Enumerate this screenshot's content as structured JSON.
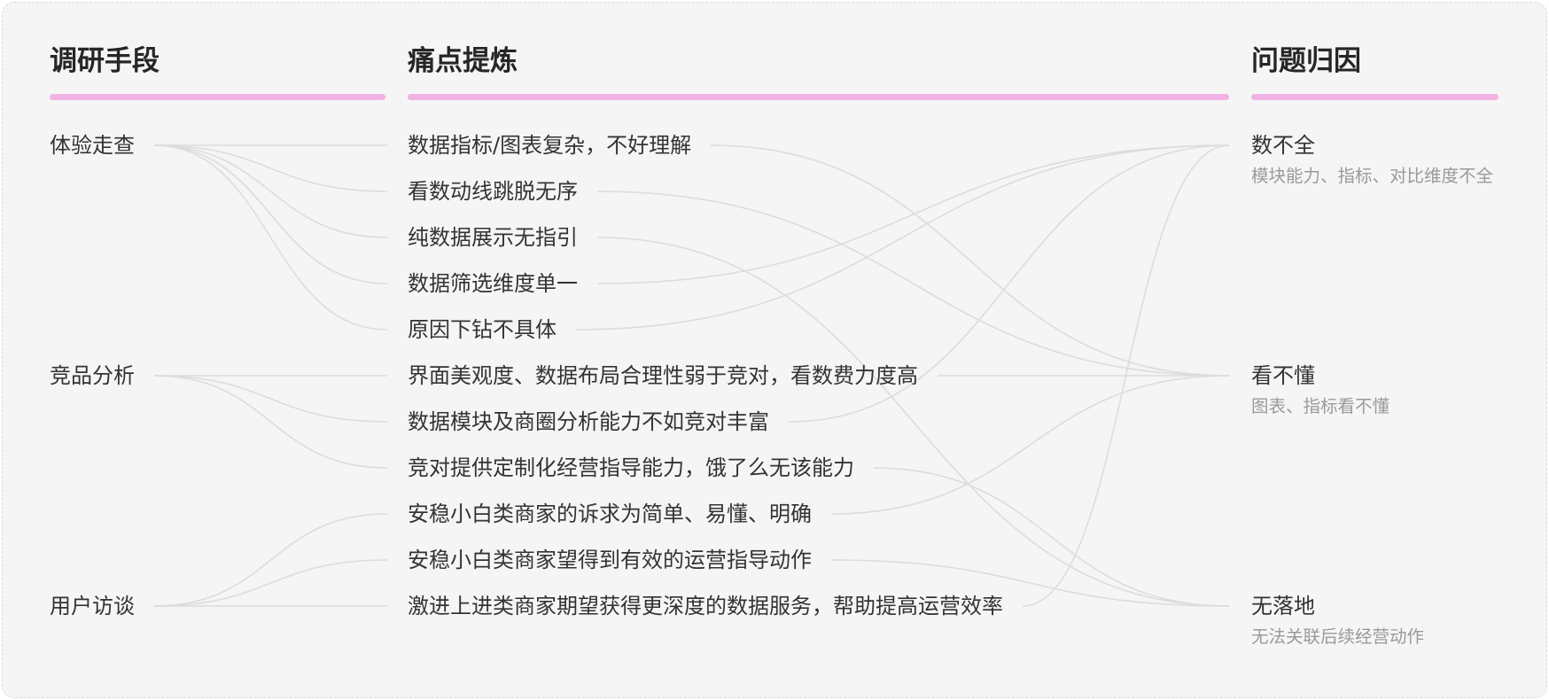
{
  "columns": {
    "methods": "调研手段",
    "pain_points": "痛点提炼",
    "causes": "问题归因"
  },
  "methods": [
    {
      "label": "体验走查"
    },
    {
      "label": "竞品分析"
    },
    {
      "label": "用户访谈"
    }
  ],
  "pain_points": [
    {
      "label": "数据指标/图表复杂，不好理解",
      "method": 0,
      "cause": 1
    },
    {
      "label": "看数动线跳脱无序",
      "method": 0,
      "cause": 1
    },
    {
      "label": "纯数据展示无指引",
      "method": 0,
      "cause": 2
    },
    {
      "label": "数据筛选维度单一",
      "method": 0,
      "cause": 0
    },
    {
      "label": "原因下钻不具体",
      "method": 0,
      "cause": 0
    },
    {
      "label": "界面美观度、数据布局合理性弱于竞对，看数费力度高",
      "method": 1,
      "cause": 1
    },
    {
      "label": "数据模块及商圈分析能力不如竞对丰富",
      "method": 1,
      "cause": 0
    },
    {
      "label": "竞对提供定制化经营指导能力，饿了么无该能力",
      "method": 1,
      "cause": 2
    },
    {
      "label": "安稳小白类商家的诉求为简单、易懂、明确",
      "method": 2,
      "cause": 1
    },
    {
      "label": "安稳小白类商家望得到有效的运营指导动作",
      "method": 2,
      "cause": 2
    },
    {
      "label": "激进上进类商家期望获得更深度的数据服务，帮助提高运营效率",
      "method": 2,
      "cause": 0
    }
  ],
  "causes": [
    {
      "label": "数不全",
      "desc": "模块能力、指标、对比维度不全"
    },
    {
      "label": "看不懂",
      "desc": "图表、指标看不懂"
    },
    {
      "label": "无落地",
      "desc": "无法关联后续经营动作"
    }
  ],
  "colors": {
    "background": "#f5f5f5",
    "frame": "#d9d9d9",
    "accent_bar": "#f0b3e3",
    "line": "#dcdcdc",
    "heading": "#262626",
    "text": "#333333",
    "muted": "#9a9a9a"
  }
}
